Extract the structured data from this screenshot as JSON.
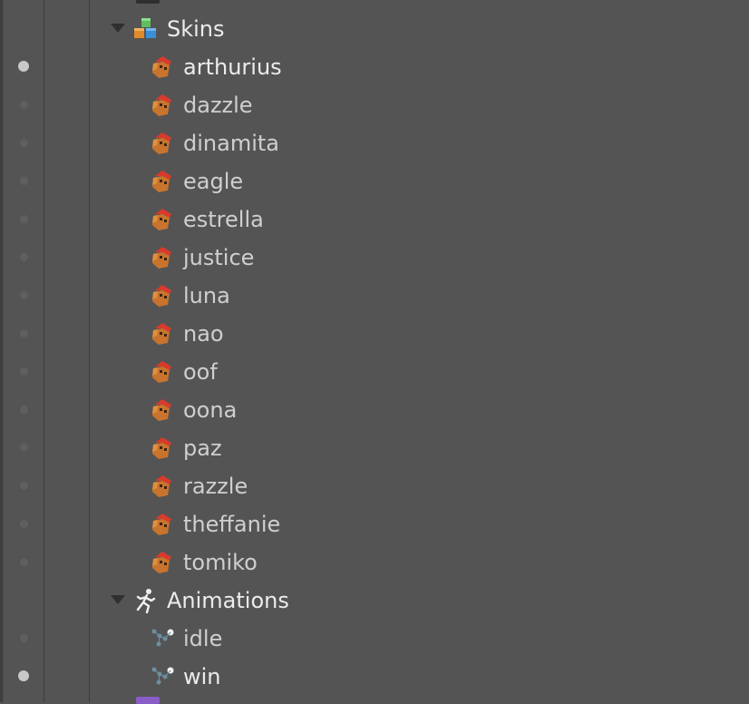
{
  "tree": {
    "skins": {
      "label": "Skins",
      "icon": "skins-cubes-icon",
      "items": [
        {
          "label": "arthurius",
          "visible": true
        },
        {
          "label": "dazzle",
          "visible": false
        },
        {
          "label": "dinamita",
          "visible": false
        },
        {
          "label": "eagle",
          "visible": false
        },
        {
          "label": "estrella",
          "visible": false
        },
        {
          "label": "justice",
          "visible": false
        },
        {
          "label": "luna",
          "visible": false
        },
        {
          "label": "nao",
          "visible": false
        },
        {
          "label": "oof",
          "visible": false
        },
        {
          "label": "oona",
          "visible": false
        },
        {
          "label": "paz",
          "visible": false
        },
        {
          "label": "razzle",
          "visible": false
        },
        {
          "label": "theffanie",
          "visible": false
        },
        {
          "label": "tomiko",
          "visible": false
        }
      ],
      "item_icon": "skin-icon"
    },
    "animations": {
      "label": "Animations",
      "icon": "running-figure-icon",
      "items": [
        {
          "label": "idle",
          "visible": false
        },
        {
          "label": "win",
          "visible": true
        }
      ],
      "item_icon": "animation-keys-icon"
    }
  },
  "colors": {
    "background": "#545454",
    "text": "#cfcfcf",
    "visibility_on": "#c9c9c9",
    "visibility_off": "#5f5f5f"
  }
}
